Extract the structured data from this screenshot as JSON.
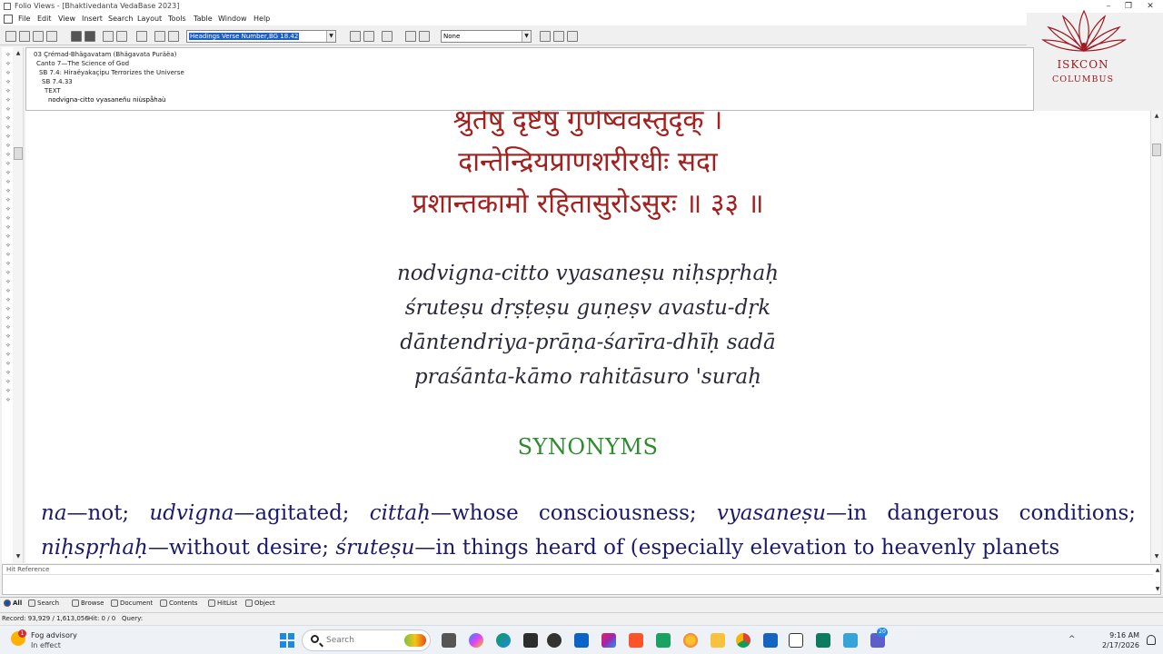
{
  "window": {
    "title": "Folio Views - [Bhaktivedanta VedaBase 2023]"
  },
  "menu": [
    "File",
    "Edit",
    "View",
    "Insert",
    "Search",
    "Layout",
    "Tools",
    "Table",
    "Window",
    "Help"
  ],
  "toolbar": {
    "query_value": "Headings Verse Number,BG 18.42",
    "style_value": "None"
  },
  "logo": {
    "name": "ISKCON",
    "sub": "COLUMBUS"
  },
  "contents_tree": [
    "03   Çrémad-Bhägavatam (Bhägavata Puräëa)",
    "Canto 7—The Science of God",
    "SB 7.4: Hiraëyakaçipu Terrorizes the Universe",
    "SB 7.4.33",
    "TEXT",
    "nodvigna-citto vyasaneñu niùspåhaù"
  ],
  "document": {
    "devanagari": [
      "श्रुतेषु दृष्टेषु गुणेष्ववस्तुदृक् ।",
      "दान्तेन्द्रियप्राणशरीरधीः सदा",
      "प्रशान्तकामो रहितासुरोऽसुरः ॥ ३३ ॥"
    ],
    "transliteration": [
      "nodvigna-citto vyasaneṣu niḥspṛhaḥ",
      "śruteṣu dṛṣṭeṣu guṇeṣv avastu-dṛk",
      "dāntendriya-prāṇa-śarīra-dhīḥ sadā",
      "praśānta-kāmo rahitāsuro 'suraḥ"
    ],
    "synonyms_heading": "SYNONYMS",
    "synonyms_line1": [
      {
        "term": "na",
        "meaning": "—not; "
      },
      {
        "term": "udvigna",
        "meaning": "—agitated; "
      },
      {
        "term": "cittaḥ",
        "meaning": "—whose consciousness; "
      },
      {
        "term": "vyasaneṣu",
        "meaning": "—in dangerous conditions;"
      }
    ],
    "synonyms_line2": [
      {
        "term": "niḥspṛhaḥ",
        "meaning": "—without desire; "
      },
      {
        "term": "śruteṣu",
        "meaning": "—in things heard of (especially elevation to heavenly planets"
      }
    ],
    "text_color": "#1c1a6a",
    "devanagari_color": "#a3201e",
    "heading_color": "#2e8b2e"
  },
  "hit_reference": {
    "label": "Hit Reference"
  },
  "tabs": [
    {
      "label": "All",
      "active": true
    },
    {
      "label": "Search",
      "active": false
    },
    {
      "label": "Browse",
      "active": false
    },
    {
      "label": "Document",
      "active": false
    },
    {
      "label": "Contents",
      "active": false
    },
    {
      "label": "HitList",
      "active": false
    },
    {
      "label": "Object",
      "active": false
    }
  ],
  "status": {
    "record": "Record: 93,929 / 1,613,056",
    "hit": "Hit: 0 / 0",
    "query": "Query:"
  },
  "taskbar": {
    "weather_line1": "Fog advisory",
    "weather_line2": "In effect",
    "weather_badge": "1",
    "search_placeholder": "Search",
    "teams_badge": "20",
    "time": "9:16 AM",
    "date": "2/17/2026"
  }
}
